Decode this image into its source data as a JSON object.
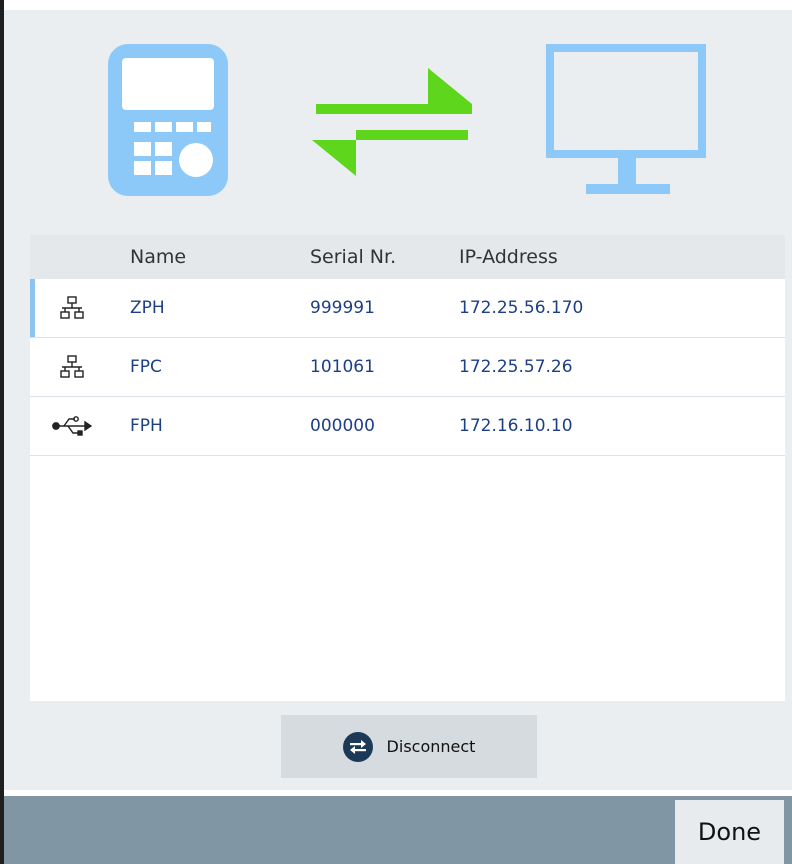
{
  "colors": {
    "device_icon": "#8cc9f8",
    "arrows": "#5ed61c",
    "link_text": "#1d3f86",
    "footer": "#8196a4"
  },
  "hero": {
    "left_icon": "handheld-instrument-icon",
    "center_icon": "bidirectional-arrows-icon",
    "right_icon": "monitor-icon"
  },
  "table": {
    "headers": {
      "name": "Name",
      "serial": "Serial Nr.",
      "ip": "IP-Address"
    },
    "rows": [
      {
        "icon": "network-icon",
        "name": "ZPH",
        "serial": "999991",
        "ip": "172.25.56.170",
        "selected": true
      },
      {
        "icon": "network-icon",
        "name": "FPC",
        "serial": "101061",
        "ip": "172.25.57.26",
        "selected": false
      },
      {
        "icon": "usb-icon",
        "name": "FPH",
        "serial": "000000",
        "ip": "172.16.10.10",
        "selected": false
      }
    ]
  },
  "disconnect": {
    "label": "Disconnect",
    "icon": "swap-icon"
  },
  "footer": {
    "done_label": "Done"
  }
}
